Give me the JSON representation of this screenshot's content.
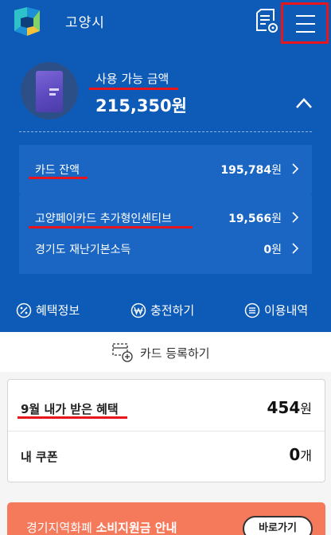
{
  "header": {
    "city": "고양시",
    "logo_icon": "goyang-logo-icon",
    "doc_icon": "document-settings-icon",
    "menu_icon": "hamburger-menu-icon"
  },
  "balance": {
    "available_label": "사용 가능 금액",
    "available_amount": "215,350원",
    "collapse_icon": "chevron-up-icon"
  },
  "rows": [
    {
      "label": "카드 잔액",
      "value": "195,784",
      "unit": "원"
    },
    {
      "label": "고양페이카드 추가형인센티브",
      "value": "19,566",
      "unit": "원"
    },
    {
      "label": "경기도 재난기본소득",
      "value": "0",
      "unit": "원"
    }
  ],
  "actions": [
    {
      "label": "혜택정보",
      "icon": "percent-icon"
    },
    {
      "label": "충전하기",
      "icon": "won-icon"
    },
    {
      "label": "이용내역",
      "icon": "list-icon"
    }
  ],
  "register": {
    "label": "카드 등록하기",
    "icon": "add-card-icon"
  },
  "benefits": {
    "month_label": "9월 내가 받은 혜택",
    "month_value": "454",
    "month_unit": "원",
    "coupon_label": "내 쿠폰",
    "coupon_value": "0",
    "coupon_unit": "개"
  },
  "banner": {
    "text_prefix": "경기지역화폐 ",
    "text_bold": "소비지원금 안내",
    "button": "바로가기"
  },
  "colors": {
    "primary": "#0d5bb7",
    "panel": "#1a66c2",
    "highlight": "#e8151c",
    "banner": "#f57a5c"
  }
}
